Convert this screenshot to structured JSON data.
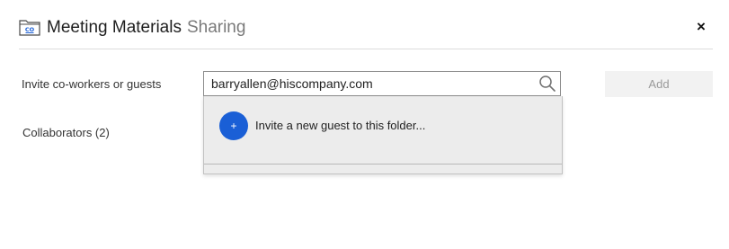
{
  "header": {
    "folder_icon": "shared-folder-icon",
    "title": "Meeting Materials",
    "title_suffix": "Sharing",
    "close_label": "×"
  },
  "invite": {
    "label": "Invite co-workers or guests",
    "input_value": "barryallen@hiscompany.com",
    "search_icon": "search-icon",
    "add_label": "Add"
  },
  "collaborators": {
    "label": "Collaborators (2)"
  },
  "dropdown": {
    "items": [
      {
        "icon": "plus-icon",
        "icon_glyph": "+",
        "label": "Invite a new guest to this folder..."
      }
    ]
  },
  "colors": {
    "accent": "#1a5fd6",
    "button_disabled_bg": "#f2f2f2",
    "button_disabled_text": "#9a9a9a",
    "dropdown_bg": "#ececec"
  }
}
